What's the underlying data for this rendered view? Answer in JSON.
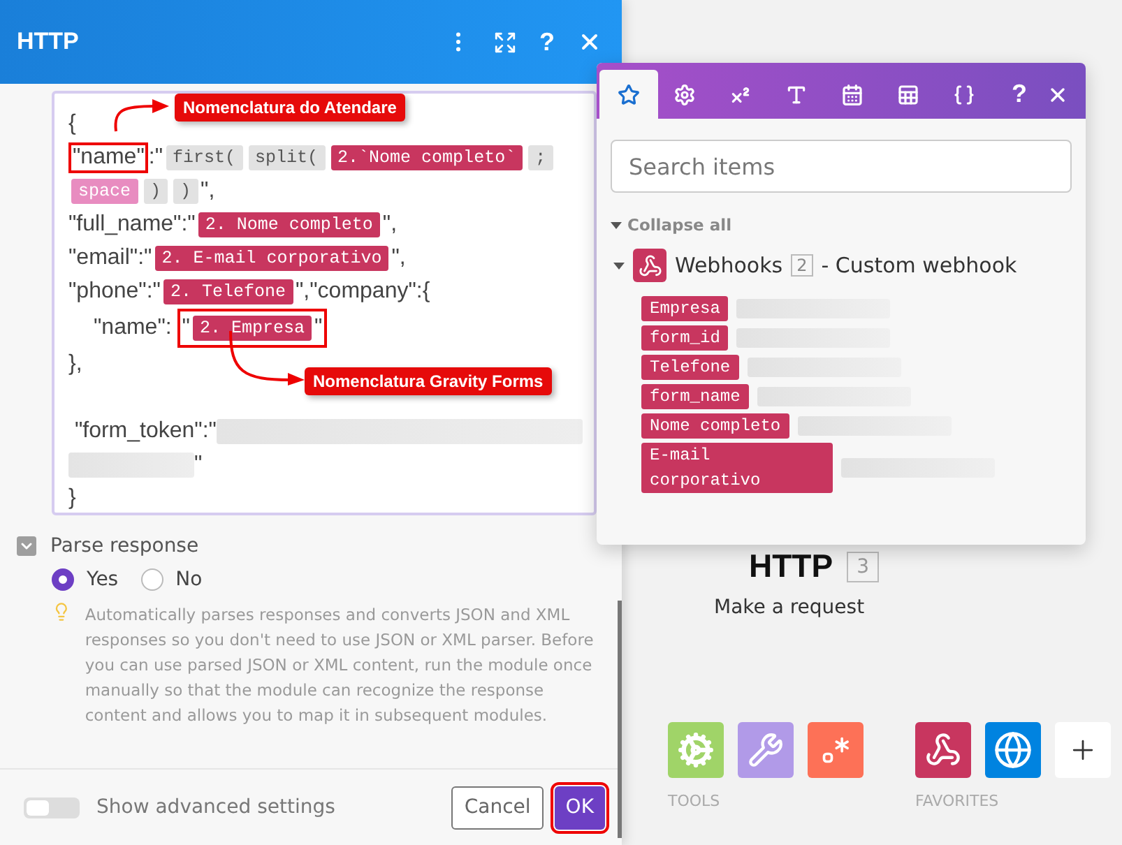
{
  "panel": {
    "title": "HTTP",
    "help_glyph": "?",
    "editor": {
      "lines": [
        {
          "segments": [
            {
              "kind": "text",
              "text": "{"
            }
          ]
        },
        {
          "segments": [
            {
              "kind": "outline",
              "children": [
                {
                  "kind": "text",
                  "text": "\"name\""
                }
              ]
            },
            {
              "kind": "text",
              "text": ":\""
            },
            {
              "kind": "fn",
              "text": "first("
            },
            {
              "kind": "fn",
              "text": "split("
            },
            {
              "kind": "var",
              "text": "2.`Nome completo`"
            },
            {
              "kind": "fn",
              "text": ";"
            },
            {
              "kind": "kw",
              "text": "space"
            },
            {
              "kind": "fn",
              "text": ")"
            },
            {
              "kind": "fn",
              "text": ")"
            },
            {
              "kind": "text",
              "text": "\","
            }
          ]
        },
        {
          "segments": [
            {
              "kind": "text",
              "text": "\"full_name\":\""
            },
            {
              "kind": "var",
              "text": "2. Nome completo"
            },
            {
              "kind": "text",
              "text": "\","
            }
          ]
        },
        {
          "segments": [
            {
              "kind": "text",
              "text": "\"email\":\""
            },
            {
              "kind": "var",
              "text": "2. E-mail corporativo"
            },
            {
              "kind": "text",
              "text": "\","
            }
          ]
        },
        {
          "segments": [
            {
              "kind": "text",
              "text": "\"phone\":\""
            },
            {
              "kind": "var",
              "text": "2. Telefone"
            },
            {
              "kind": "text",
              "text": "\",\"company\":{"
            }
          ]
        },
        {
          "indent": true,
          "segments": [
            {
              "kind": "text",
              "text": "\"name\": "
            },
            {
              "kind": "outline",
              "children": [
                {
                  "kind": "text",
                  "text": "\""
                },
                {
                  "kind": "var",
                  "text": "2. Empresa"
                },
                {
                  "kind": "text",
                  "text": "\""
                }
              ]
            }
          ]
        },
        {
          "segments": [
            {
              "kind": "text",
              "text": "},"
            }
          ]
        },
        {
          "kind": "blank"
        },
        {
          "segments": [
            {
              "kind": "text",
              "text": " \"form_token\":\""
            },
            {
              "kind": "redacted"
            }
          ]
        },
        {
          "segments": [
            {
              "kind": "redacted"
            },
            {
              "kind": "text",
              "text": "\""
            }
          ]
        },
        {
          "segments": [
            {
              "kind": "text",
              "text": "}"
            }
          ]
        }
      ],
      "annotations": [
        {
          "text": "Nomenclatura do Atendare"
        },
        {
          "text": "Nomenclatura Gravity Forms"
        }
      ]
    },
    "parse_response": {
      "label": "Parse response",
      "expanded": true,
      "options": [
        {
          "label": "Yes",
          "selected": true
        },
        {
          "label": "No",
          "selected": false
        }
      ],
      "hint": "Automatically parses responses and converts JSON and XML responses so you don't need to use JSON or XML parser. Before you can use parsed JSON or XML content, run the module once manually so that the module can recognize the response content and allows you to map it in subsequent modules."
    },
    "advanced_settings": {
      "label": "Show advanced settings",
      "on": false
    },
    "buttons": [
      {
        "label": "Cancel",
        "kind": "secondary",
        "highlighted": false
      },
      {
        "label": "OK",
        "kind": "primary",
        "highlighted": true
      }
    ]
  },
  "mapper": {
    "tabs": [
      {
        "kind": "star",
        "selected": true
      },
      {
        "kind": "gear",
        "selected": false
      },
      {
        "kind": "superscript",
        "selected": false
      },
      {
        "kind": "text",
        "selected": false
      },
      {
        "kind": "calendar",
        "selected": false
      },
      {
        "kind": "table",
        "selected": false
      },
      {
        "kind": "braces",
        "selected": false
      }
    ],
    "help_glyph": "?",
    "search": {
      "placeholder": "Search items"
    },
    "collapse_all": "Collapse all",
    "module": {
      "name": "Webhooks",
      "badge": "2",
      "subtitle": "- Custom webhook",
      "expanded": true,
      "items": [
        {
          "label": "Empresa"
        },
        {
          "label": "form_id"
        },
        {
          "label": "Telefone"
        },
        {
          "label": "form_name"
        },
        {
          "label": "Nome completo"
        },
        {
          "label": "E-mail corporativo"
        }
      ]
    }
  },
  "canvas": {
    "module": {
      "title": "HTTP",
      "badge": "3",
      "subtitle": "Make a request"
    },
    "groups": [
      {
        "label": "TOOLS",
        "items": [
          {
            "kind": "gear",
            "color": "#a0d468"
          },
          {
            "kind": "tools",
            "color": "#b19ae8"
          },
          {
            "kind": "regex",
            "color": "#fd7157"
          }
        ]
      },
      {
        "label": "FAVORITES",
        "items": [
          {
            "kind": "webhook",
            "color": "#c8365f"
          },
          {
            "kind": "globe",
            "color": "#0083e0"
          },
          {
            "kind": "add",
            "color": "#ffffff"
          }
        ]
      }
    ]
  }
}
